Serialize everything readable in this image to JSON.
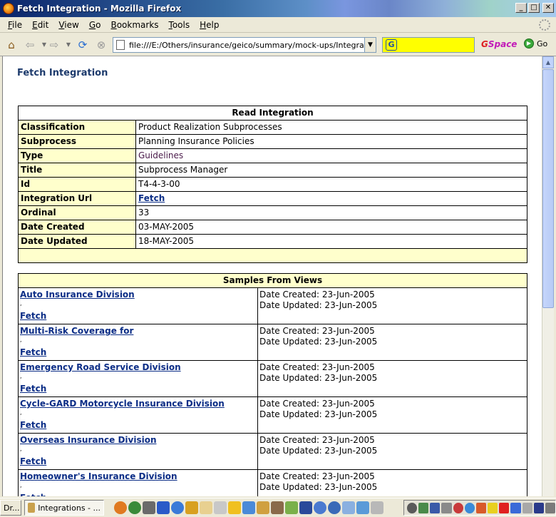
{
  "window": {
    "title": "Fetch Integration - Mozilla Firefox"
  },
  "menu": [
    "File",
    "Edit",
    "View",
    "Go",
    "Bookmarks",
    "Tools",
    "Help"
  ],
  "menu_mnemonics": [
    "F",
    "E",
    "V",
    "G",
    "B",
    "T",
    "H"
  ],
  "toolbar": {
    "url": "file:///E:/Others/insurance/geico/summary/mock-ups/Integrations.l",
    "search_brand": "G",
    "gspace_g": "G",
    "gspace_rest": "Space",
    "go_label": "Go"
  },
  "page": {
    "title": "Fetch Integration",
    "read_header": "Read Integration",
    "fields": [
      {
        "label": "Classification",
        "value": "Product Realization Subprocesses",
        "link": false
      },
      {
        "label": "Subprocess",
        "value": "Planning Insurance Policies",
        "link": false
      },
      {
        "label": "Type",
        "value": "Guidelines",
        "link": false
      },
      {
        "label": "Title",
        "value": "Subprocess Manager",
        "link": false
      },
      {
        "label": "Id",
        "value": "T4-4-3-00",
        "link": false
      },
      {
        "label": "Integration Url",
        "value": "Fetch",
        "link": true
      },
      {
        "label": "Ordinal",
        "value": "33",
        "link": false
      },
      {
        "label": "Date Created",
        "value": "03-MAY-2005",
        "link": false
      },
      {
        "label": "Date Updated",
        "value": "18-MAY-2005",
        "link": false
      }
    ],
    "samples_header": "Samples From Views",
    "samples": [
      {
        "name": "Auto Insurance Division",
        "link": "Fetch",
        "created": "Date Created: 23-Jun-2005",
        "updated": "Date Updated: 23-Jun-2005"
      },
      {
        "name": "Multi-Risk Coverage for",
        "link": "Fetch",
        "created": "Date Created: 23-Jun-2005",
        "updated": "Date Updated: 23-Jun-2005"
      },
      {
        "name": "Emergency Road Service Division",
        "link": "Fetch",
        "created": "Date Created: 23-Jun-2005",
        "updated": "Date Updated: 23-Jun-2005"
      },
      {
        "name": "Cycle-GARD Motorcycle Insurance Division",
        "link": "Fetch",
        "created": "Date Created: 23-Jun-2005",
        "updated": "Date Updated: 23-Jun-2005"
      },
      {
        "name": "Overseas Insurance Division",
        "link": "Fetch",
        "created": "Date Created: 23-Jun-2005",
        "updated": "Date Updated: 23-Jun-2005"
      },
      {
        "name": "Homeowner's Insurance Division",
        "link": "Fetch",
        "created": "Date Created: 23-Jun-2005",
        "updated": "Date Updated: 23-Jun-2005"
      }
    ]
  },
  "taskbar": {
    "tasks": [
      "Dr...",
      "Integrations - ..."
    ]
  },
  "colors": {
    "label_bg": "#ffffcc",
    "link": "#0b2d86",
    "title": "#1c3a6c",
    "search_bg": "#ffff00"
  }
}
